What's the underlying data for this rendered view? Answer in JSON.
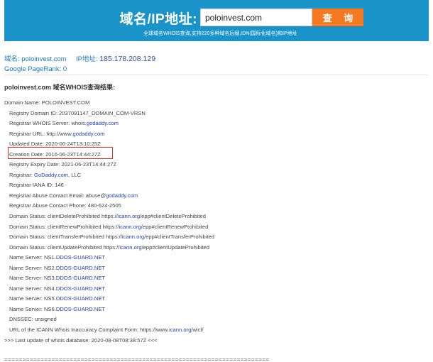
{
  "search": {
    "label": "域名/IP地址:",
    "value": "poloinvest.com",
    "button": "查 询",
    "tip": "全球域名WHOIS查询,支持220多种域名后缀,IDN(国际化域名)和IP地址"
  },
  "meta": {
    "domain_key": "域名:",
    "domain_value": "poloinvest.com",
    "ip_key": "IP地址:",
    "ip_value": "185.178.208.129",
    "pagerank_key": "Google PageRank:",
    "pagerank_value": "0"
  },
  "result_title": "poloinvest.com 域名WHOIS查询结果:",
  "whois": [
    {
      "indent": false,
      "parts": [
        {
          "t": "Domain Name: POLOINVEST.COM"
        }
      ]
    },
    {
      "indent": true,
      "parts": [
        {
          "t": "Registry Domain ID: 2037091147_DOMAIN_COM-VRSN"
        }
      ]
    },
    {
      "indent": true,
      "parts": [
        {
          "t": "Registrar WHOIS Server: whois."
        },
        {
          "t": "godaddy.com",
          "link": true
        }
      ]
    },
    {
      "indent": true,
      "parts": [
        {
          "t": "Registrar URL: http://www."
        },
        {
          "t": "godaddy.com",
          "link": true
        }
      ]
    },
    {
      "indent": true,
      "parts": [
        {
          "t": "Updated Date: 2020-06-24T13:10:25Z"
        }
      ]
    },
    {
      "indent": true,
      "parts": [
        {
          "t": "Creation Date: 2016-06-23T14:44:27Z"
        }
      ]
    },
    {
      "indent": true,
      "parts": [
        {
          "t": "Registry Expiry Date: 2021-06-23T14:44:27Z"
        }
      ]
    },
    {
      "indent": true,
      "parts": [
        {
          "t": "Registrar: "
        },
        {
          "t": "GoDaddy.com",
          "link": true
        },
        {
          "t": ", LLC"
        }
      ]
    },
    {
      "indent": true,
      "parts": [
        {
          "t": "Registrar IANA ID: 146"
        }
      ]
    },
    {
      "indent": true,
      "parts": [
        {
          "t": "Registrar Abuse Contact Email: abuse@"
        },
        {
          "t": "godaddy.com",
          "link": true
        }
      ]
    },
    {
      "indent": true,
      "parts": [
        {
          "t": "Registrar Abuse Contact Phone: 480-624-2505"
        }
      ]
    },
    {
      "indent": true,
      "parts": [
        {
          "t": "Domain Status: clientDeleteProhibited https://"
        },
        {
          "t": "icann.org",
          "link": true
        },
        {
          "t": "/epp#clientDeleteProhibited"
        }
      ]
    },
    {
      "indent": true,
      "parts": [
        {
          "t": "Domain Status: clientRenewProhibited https://"
        },
        {
          "t": "icann.org",
          "link": true
        },
        {
          "t": "/epp#clientRenewProhibited"
        }
      ]
    },
    {
      "indent": true,
      "parts": [
        {
          "t": "Domain Status: clientTransferProhibited https://"
        },
        {
          "t": "icann.org",
          "link": true
        },
        {
          "t": "/epp#clientTransferProhibited"
        }
      ]
    },
    {
      "indent": true,
      "parts": [
        {
          "t": "Domain Status: clientUpdateProhibited https://"
        },
        {
          "t": "icann.org",
          "link": true
        },
        {
          "t": "/epp#clientUpdateProhibited"
        }
      ]
    },
    {
      "indent": true,
      "parts": [
        {
          "t": "Name Server: NS1."
        },
        {
          "t": "DDOS-GUARD.NET",
          "link": true
        }
      ]
    },
    {
      "indent": true,
      "parts": [
        {
          "t": "Name Server: NS2."
        },
        {
          "t": "DDOS-GUARD.NET",
          "link": true
        }
      ]
    },
    {
      "indent": true,
      "parts": [
        {
          "t": "Name Server: NS3."
        },
        {
          "t": "DDOS-GUARD.NET",
          "link": true
        }
      ]
    },
    {
      "indent": true,
      "parts": [
        {
          "t": "Name Server: NS4."
        },
        {
          "t": "DDOS-GUARD.NET",
          "link": true
        }
      ]
    },
    {
      "indent": true,
      "parts": [
        {
          "t": "Name Server: NS5."
        },
        {
          "t": "DDOS-GUARD.NET",
          "link": true
        }
      ]
    },
    {
      "indent": true,
      "parts": [
        {
          "t": "Name Server: NS6."
        },
        {
          "t": "DDOS-GUARD.NET",
          "link": true
        }
      ]
    },
    {
      "indent": true,
      "parts": [
        {
          "t": "DNSSEC: unsigned"
        }
      ]
    },
    {
      "indent": true,
      "parts": [
        {
          "t": "URL of the ICANN Whois Inaccuracy Complaint Form: https://www."
        },
        {
          "t": "icann.org",
          "link": true
        },
        {
          "t": "/wicf/"
        }
      ]
    },
    {
      "indent": false,
      "parts": [
        {
          "t": ">>> Last update of whois database: 2020-08-08T08:38:57Z <<<"
        }
      ]
    }
  ],
  "separator": "=========================================================================",
  "colors": {
    "banner": "#1a93c9",
    "button": "#f47920",
    "link": "#1f3fb5",
    "highlight": "#e0331f"
  }
}
